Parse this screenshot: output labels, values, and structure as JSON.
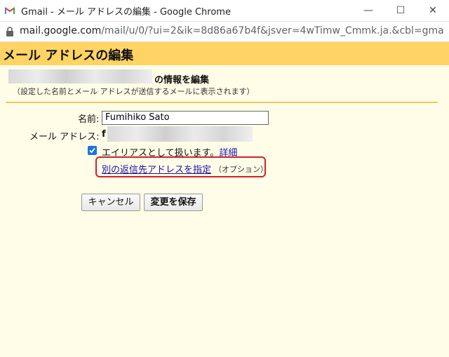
{
  "window": {
    "title": "Gmail - メール アドレスの編集 - Google Chrome",
    "minimize_glyph": "—",
    "maximize_glyph": "☐",
    "close_glyph": "✕"
  },
  "address_bar": {
    "host": "mail.google.com",
    "path": "/mail/u/0/?ui=2&ik=8d86a67b4f&jsver=4wTimw_Cmmk.ja.&cbl=gmail_fe_..."
  },
  "header": {
    "title": "メール アドレスの編集"
  },
  "info": {
    "title_suffix": "の情報を編集",
    "subtitle": "（設定した名前とメール アドレスが送信するメールに表示されます）"
  },
  "form": {
    "name_label": "名前:",
    "name_value": "Fumihiko Sato",
    "email_label": "メール アドレス:",
    "email_visible_prefix": "f",
    "alias_checked": true,
    "alias_text": "エイリアスとして扱います。",
    "alias_link": "詳細",
    "reply_to_link": "別の返信先アドレスを指定",
    "reply_to_optional": "（オプション）"
  },
  "buttons": {
    "cancel": "キャンセル",
    "save": "変更を保存"
  },
  "colors": {
    "header_bg": "#ffd464",
    "page_bg": "#fffde7",
    "highlight_border": "#d0222a",
    "link": "#1a0dab",
    "checkbox": "#1a73e8"
  }
}
